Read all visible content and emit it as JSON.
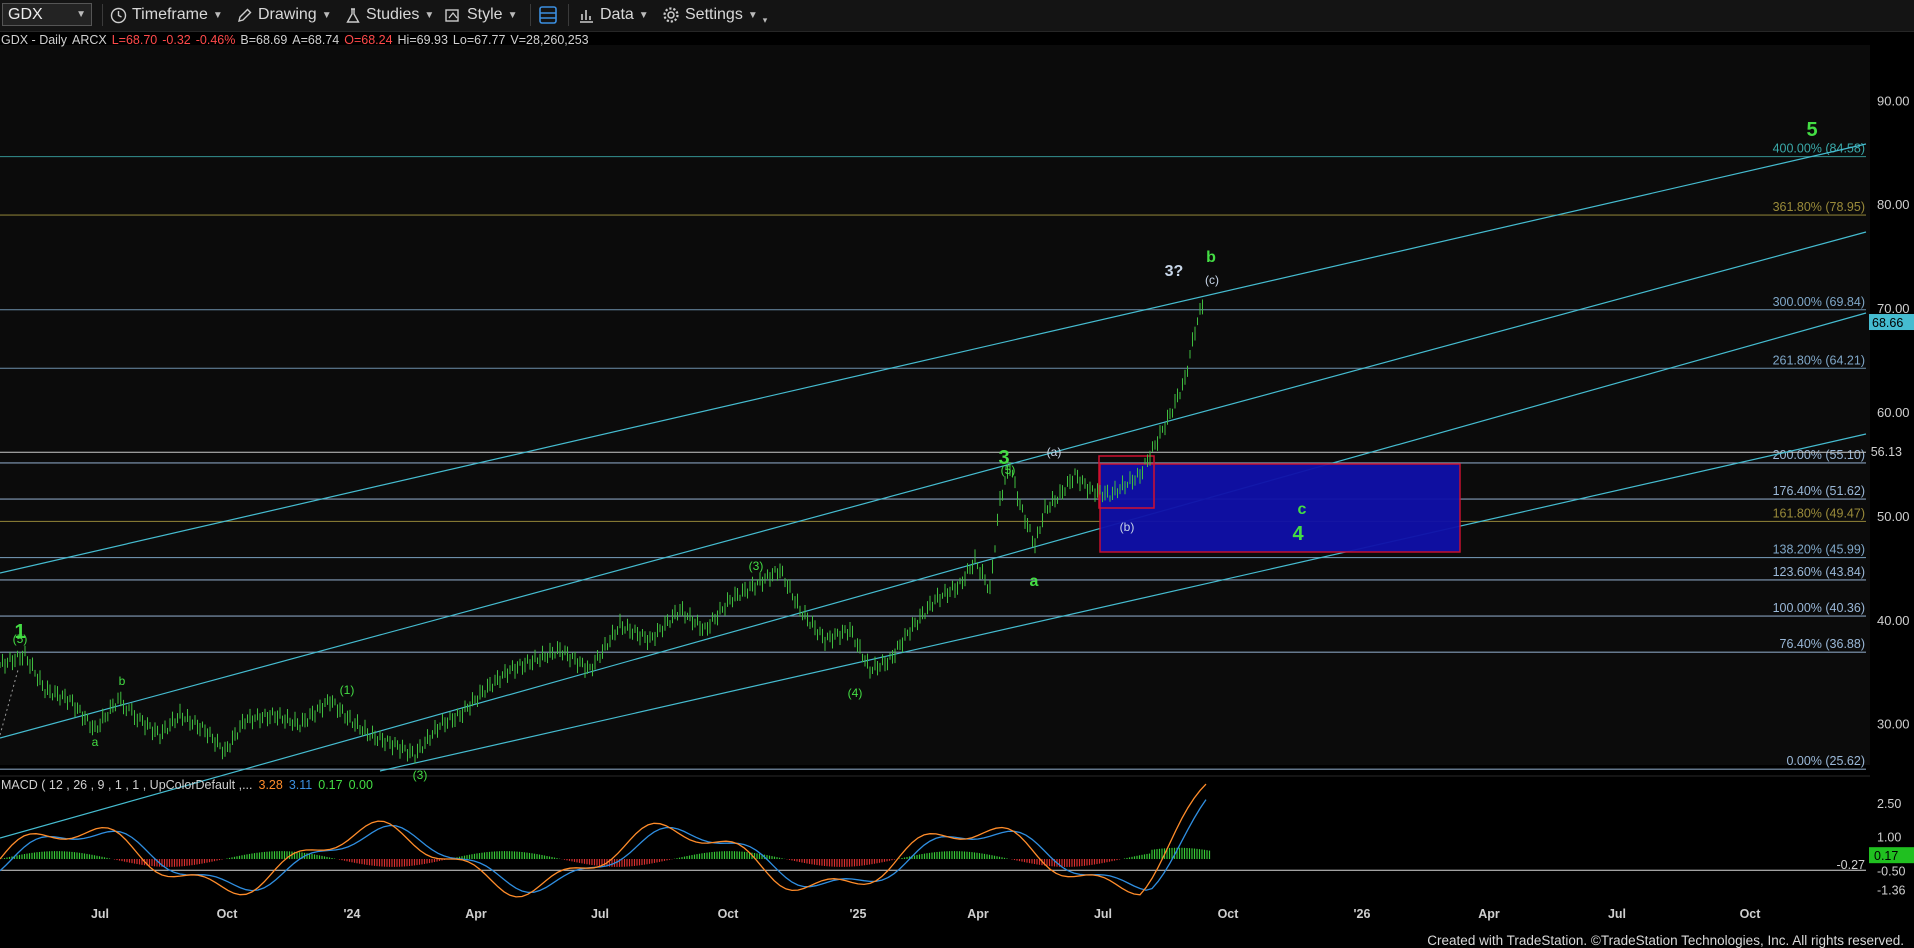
{
  "toolbar": {
    "symbol": "GDX",
    "timeframe": "Timeframe",
    "drawing": "Drawing",
    "studies": "Studies",
    "style": "Style",
    "data": "Data",
    "settings": "Settings"
  },
  "quote": {
    "name": "GDX - Daily",
    "exchange": "ARCX",
    "last": "L=68.70",
    "change": "-0.32",
    "pct": "-0.46%",
    "bid": "B=68.69",
    "ask": "A=68.74",
    "open": "O=68.24",
    "high": "Hi=69.93",
    "low": "Lo=67.77",
    "volume": "V=28,260,253"
  },
  "price_axis": {
    "ticks": [
      "90.00",
      "80.00",
      "70.00",
      "60.00",
      "50.00",
      "40.00",
      "30.00"
    ],
    "current_price": "68.66",
    "extra_label": "56.13"
  },
  "fib_levels": [
    {
      "label": "400.00% (84.58)",
      "value": 84.58,
      "color": "#3aa9a9"
    },
    {
      "label": "361.80% (78.95)",
      "value": 78.95,
      "color": "#9a8b3a"
    },
    {
      "label": "300.00% (69.84)",
      "value": 69.84,
      "color": "#7fa7c8"
    },
    {
      "label": "261.80% (64.21)",
      "value": 64.21,
      "color": "#7fa7c8"
    },
    {
      "label": "200.00% (55.10)",
      "value": 55.1,
      "color": "#9ab8d8"
    },
    {
      "label": "176.40% (51.62)",
      "value": 51.62,
      "color": "#9ab8d8"
    },
    {
      "label": "161.80% (49.47)",
      "value": 49.47,
      "color": "#9a8b3a"
    },
    {
      "label": "138.20% (45.99)",
      "value": 45.99,
      "color": "#7fa7c8"
    },
    {
      "label": "123.60% (43.84)",
      "value": 43.84,
      "color": "#9ab8d8"
    },
    {
      "label": "100.00% (40.36)",
      "value": 40.36,
      "color": "#9ab8d8"
    },
    {
      "label": "76.40% (36.88)",
      "value": 36.88,
      "color": "#9ab8d8"
    },
    {
      "label": "0.00% (25.62)",
      "value": 25.62,
      "color": "#9ab8d8"
    }
  ],
  "date_axis": [
    "Jul",
    "Oct",
    "'24",
    "Apr",
    "Jul",
    "Oct",
    "'25",
    "Apr",
    "Jul",
    "Oct",
    "'26",
    "Apr",
    "Jul",
    "Oct"
  ],
  "wave_labels": {
    "green_big": [
      "1",
      "3",
      "5",
      "4"
    ],
    "green_small": [
      "b",
      "c",
      "a",
      "(3)",
      "(4)",
      "(5)",
      "(5)",
      "a",
      "b",
      "(1)",
      "(3)"
    ],
    "white": [
      "3?",
      "(c)",
      "(a)",
      "(b)"
    ]
  },
  "macd": {
    "label": "MACD ( 12 , 26 , 9 , 1 , 1 , UpColorDefault ,...",
    "value1": "3.28",
    "value2": "3.11",
    "value3": "0.17",
    "value4": "0.00",
    "axis_ticks": [
      "2.50",
      "1.00",
      "-0.50",
      "-1.36"
    ],
    "flag_values": [
      "-0.27",
      "0.17"
    ]
  },
  "footer": "Created with TradeStation. ©TradeStation Technologies, Inc. All rights reserved.",
  "colors": {
    "price_bars": "#3fbe3f",
    "channel": "#45bcd0",
    "target_box": "#1010a8",
    "target_border": "#d01030",
    "label_green": "#44dd44",
    "macd_line": "#ff8c2a",
    "signal_line": "#2f8ee0"
  }
}
